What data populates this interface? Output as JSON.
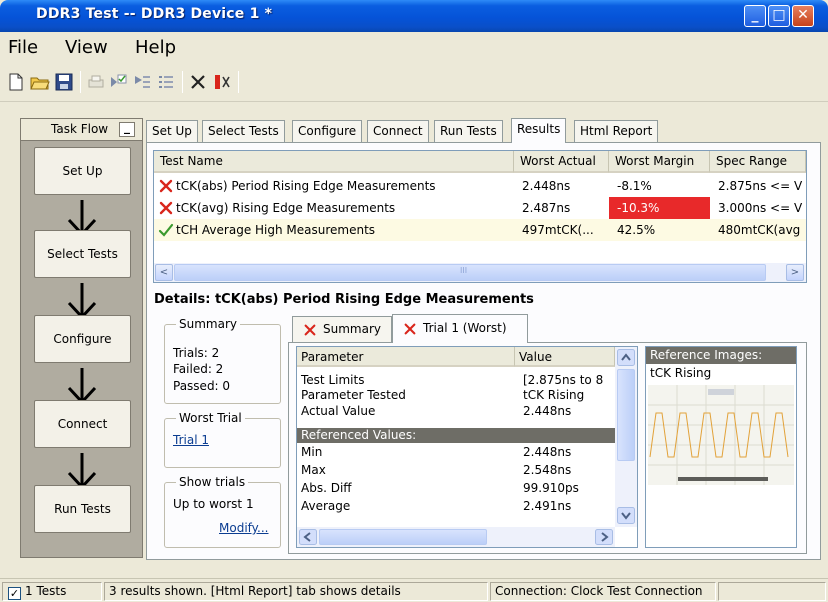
{
  "window": {
    "title": "DDR3 Test -- DDR3 Device 1 *",
    "minimize": "_",
    "restore": "□",
    "close": "✕"
  },
  "menu": [
    "File",
    "View",
    "Help"
  ],
  "toolbar": {
    "icons": [
      "new-icon",
      "open-icon",
      "save-icon",
      "print-icon",
      "run-selected-icon",
      "run-icon",
      "list-icon",
      "close-icon",
      "stop-icon"
    ]
  },
  "taskflow": {
    "header": "Task Flow",
    "minimize": "_",
    "steps": [
      "Set Up",
      "Select Tests",
      "Configure",
      "Connect",
      "Run Tests"
    ]
  },
  "tabs": [
    "Set Up",
    "Select Tests",
    "Configure",
    "Connect",
    "Run Tests",
    "Results",
    "Html Report"
  ],
  "active_tab": "Results",
  "results": {
    "columns": [
      "Test Name",
      "Worst Actual",
      "Worst Margin",
      "Spec Range"
    ],
    "rows": [
      {
        "status": "fail",
        "name": "tCK(abs) Period Rising Edge Measurements",
        "worst_actual": "2.448ns",
        "worst_margin": "-8.1%",
        "spec_range": "2.875ns <= V"
      },
      {
        "status": "fail",
        "name": "tCK(avg) Rising Edge Measurements",
        "worst_actual": "2.487ns",
        "worst_margin": "-10.3%",
        "spec_range": "3.000ns <= V"
      },
      {
        "status": "pass",
        "name": "tCH Average High Measurements",
        "worst_actual": "497mtCK(...",
        "worst_margin": "42.5%",
        "spec_range": "480mtCK(avg"
      }
    ],
    "scroll_left": "<",
    "scroll_right": ">",
    "scroll_grip": "III"
  },
  "details": {
    "title": "Details: tCK(abs) Period Rising Edge Measurements",
    "summary": {
      "label": "Summary",
      "trials": "Trials: 2",
      "failed": "Failed: 2",
      "passed": "Passed: 0"
    },
    "worst_trial": {
      "label": "Worst Trial",
      "link": "Trial 1"
    },
    "show_trials": {
      "label": "Show trials",
      "value": "Up to worst 1",
      "modify": "Modify..."
    },
    "tabs": [
      "Summary",
      "Trial 1 (Worst)"
    ],
    "active_tab": "Trial 1 (Worst)",
    "param_columns": [
      "Parameter",
      "Value"
    ],
    "params": [
      {
        "type": "row",
        "name": "Test Limits",
        "value": "[2.875ns to 8"
      },
      {
        "type": "row",
        "name": "Parameter Tested",
        "value": "tCK Rising"
      },
      {
        "type": "row",
        "name": "Actual Value",
        "value": "2.448ns"
      },
      {
        "type": "section",
        "name": "Referenced Values:",
        "value": ""
      },
      {
        "type": "row",
        "name": "Min",
        "value": "2.448ns"
      },
      {
        "type": "row",
        "name": "Max",
        "value": "2.548ns"
      },
      {
        "type": "row",
        "name": "Abs. Diff",
        "value": "99.910ps"
      },
      {
        "type": "row",
        "name": "Average",
        "value": "2.491ns"
      }
    ],
    "reference_images": {
      "title": "Reference Images:",
      "label": "tCK Rising"
    }
  },
  "statusbar": {
    "tests": "1 Tests",
    "message": "3 results shown. [Html Report] tab shows details",
    "connection": "Connection: Clock Test Connection"
  },
  "colors": {
    "fail": "#d9261c",
    "pass": "#3a9a2e",
    "highlight_margin": "#e8292a",
    "selected_row": "#fdfae3"
  }
}
